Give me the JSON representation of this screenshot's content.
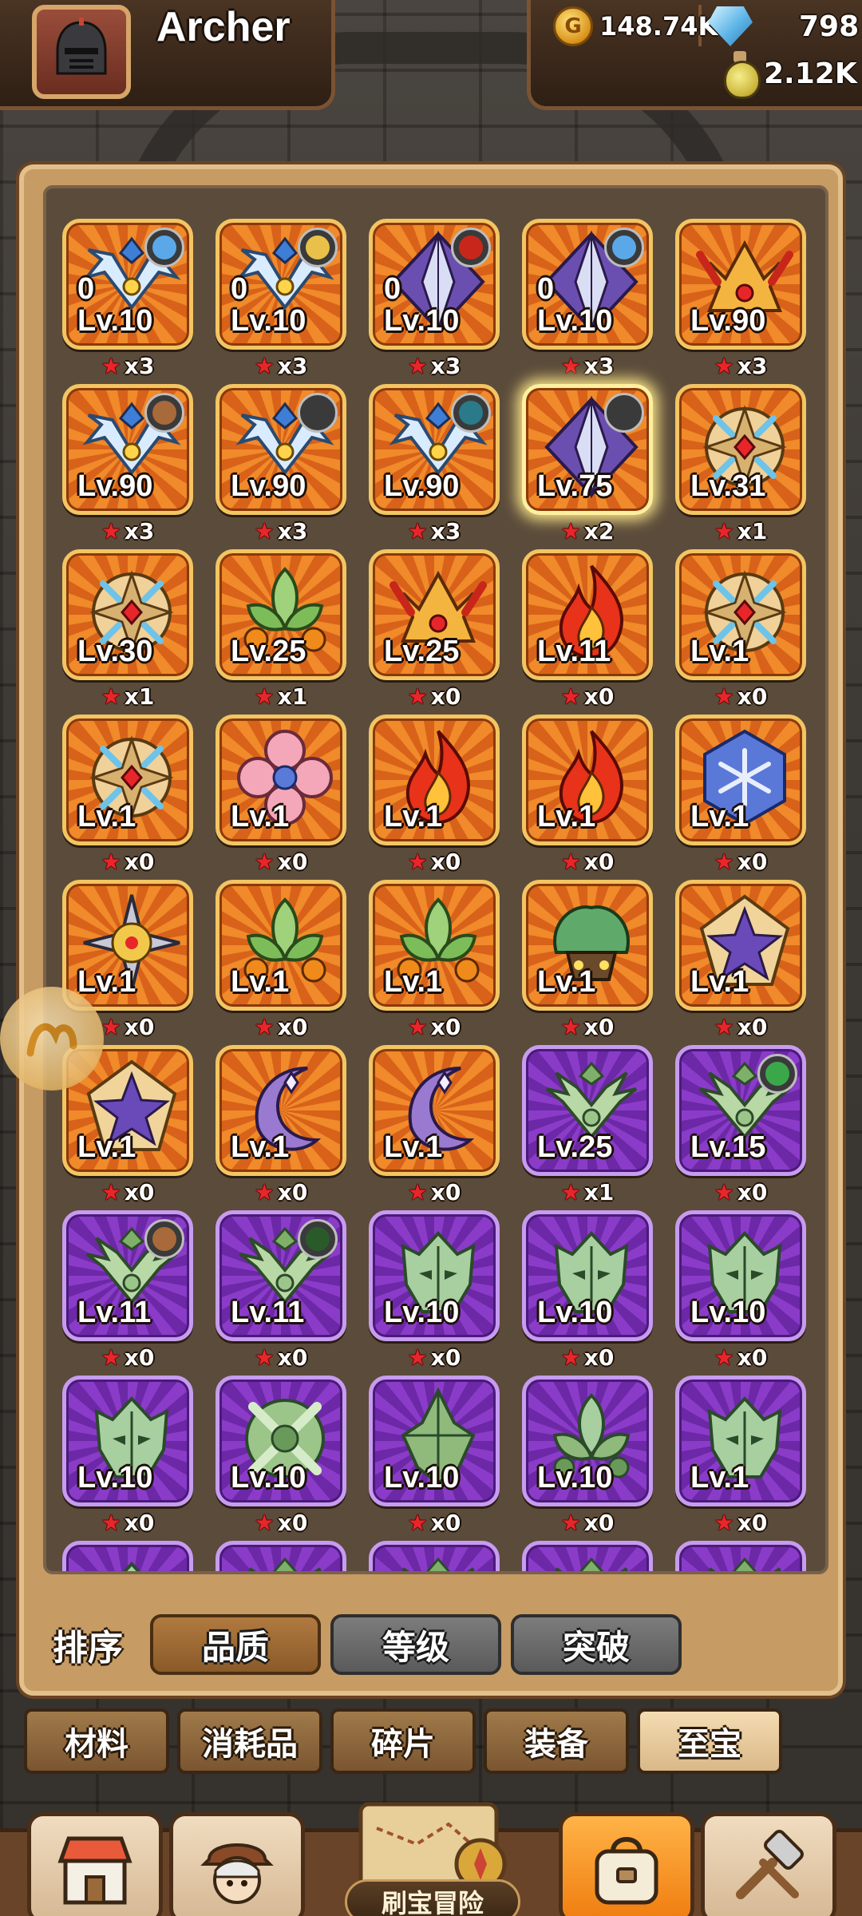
{
  "player": {
    "name": "Archer"
  },
  "resources": {
    "gold": "148.74K",
    "gems": "798",
    "potion": "2.12K"
  },
  "inventory": {
    "items": [
      {
        "rarity": "orange",
        "art": "wings-blue",
        "level": "Lv.10",
        "sub": "0",
        "count": "x3",
        "hero": "blue"
      },
      {
        "rarity": "orange",
        "art": "wings-blue",
        "level": "Lv.10",
        "sub": "0",
        "count": "x3",
        "hero": "gold"
      },
      {
        "rarity": "orange",
        "art": "diamond",
        "level": "Lv.10",
        "sub": "0",
        "count": "x3",
        "hero": "red"
      },
      {
        "rarity": "orange",
        "art": "diamond",
        "level": "Lv.10",
        "sub": "0",
        "count": "x3",
        "hero": "blue"
      },
      {
        "rarity": "orange",
        "art": "flame-crown",
        "level": "Lv.90",
        "sub": "",
        "count": "x3",
        "hero": ""
      },
      {
        "rarity": "orange",
        "art": "wings-blue",
        "level": "Lv.90",
        "sub": "",
        "count": "x3",
        "hero": "brown"
      },
      {
        "rarity": "orange",
        "art": "wings-blue",
        "level": "Lv.90",
        "sub": "",
        "count": "x3",
        "hero": "dark"
      },
      {
        "rarity": "orange",
        "art": "wings-blue",
        "level": "Lv.90",
        "sub": "",
        "count": "x3",
        "hero": "teal"
      },
      {
        "rarity": "orange",
        "art": "diamond",
        "level": "Lv.75",
        "sub": "",
        "count": "x2",
        "hero": "dark",
        "selected": true
      },
      {
        "rarity": "orange",
        "art": "shield",
        "level": "Lv.31",
        "sub": "",
        "count": "x1",
        "hero": ""
      },
      {
        "rarity": "orange",
        "art": "shield",
        "level": "Lv.30",
        "sub": "",
        "count": "x1",
        "hero": ""
      },
      {
        "rarity": "orange",
        "art": "leaf",
        "level": "Lv.25",
        "sub": "",
        "count": "x1",
        "hero": ""
      },
      {
        "rarity": "orange",
        "art": "flame-crown",
        "level": "Lv.25",
        "sub": "",
        "count": "x0",
        "hero": ""
      },
      {
        "rarity": "orange",
        "art": "fire",
        "level": "Lv.11",
        "sub": "",
        "count": "x0",
        "hero": ""
      },
      {
        "rarity": "orange",
        "art": "shield",
        "level": "Lv.1",
        "sub": "",
        "count": "x0",
        "hero": ""
      },
      {
        "rarity": "orange",
        "art": "shield",
        "level": "Lv.1",
        "sub": "",
        "count": "x0",
        "hero": ""
      },
      {
        "rarity": "orange",
        "art": "flower",
        "level": "Lv.1",
        "sub": "",
        "count": "x0",
        "hero": ""
      },
      {
        "rarity": "orange",
        "art": "fire",
        "level": "Lv.1",
        "sub": "",
        "count": "x0",
        "hero": ""
      },
      {
        "rarity": "orange",
        "art": "fire",
        "level": "Lv.1",
        "sub": "",
        "count": "x0",
        "hero": ""
      },
      {
        "rarity": "orange",
        "art": "hex-snow",
        "level": "Lv.1",
        "sub": "",
        "count": "x0",
        "hero": ""
      },
      {
        "rarity": "orange",
        "art": "shuriken",
        "level": "Lv.1",
        "sub": "",
        "count": "x0",
        "hero": ""
      },
      {
        "rarity": "orange",
        "art": "leaf",
        "level": "Lv.1",
        "sub": "",
        "count": "x0",
        "hero": ""
      },
      {
        "rarity": "orange",
        "art": "leaf",
        "level": "Lv.1",
        "sub": "",
        "count": "x0",
        "hero": ""
      },
      {
        "rarity": "orange",
        "art": "tree",
        "level": "Lv.1",
        "sub": "",
        "count": "x0",
        "hero": ""
      },
      {
        "rarity": "orange",
        "art": "star-pentagon",
        "level": "Lv.1",
        "sub": "",
        "count": "x0",
        "hero": ""
      },
      {
        "rarity": "orange",
        "art": "star-pentagon",
        "level": "Lv.1",
        "sub": "",
        "count": "x0",
        "hero": ""
      },
      {
        "rarity": "orange",
        "art": "moon",
        "level": "Lv.1",
        "sub": "",
        "count": "x0",
        "hero": ""
      },
      {
        "rarity": "orange",
        "art": "moon",
        "level": "Lv.1",
        "sub": "",
        "count": "x0",
        "hero": ""
      },
      {
        "rarity": "purple",
        "art": "wings-green",
        "level": "Lv.25",
        "sub": "",
        "count": "x1",
        "hero": ""
      },
      {
        "rarity": "purple",
        "art": "wings-green",
        "level": "Lv.15",
        "sub": "",
        "count": "x0",
        "hero": "green"
      },
      {
        "rarity": "purple",
        "art": "wings-green",
        "level": "Lv.11",
        "sub": "",
        "count": "x0",
        "hero": "brown"
      },
      {
        "rarity": "purple",
        "art": "wings-green",
        "level": "Lv.11",
        "sub": "",
        "count": "x0",
        "hero": "hood"
      },
      {
        "rarity": "purple",
        "art": "mask-green",
        "level": "Lv.10",
        "sub": "",
        "count": "x0",
        "hero": ""
      },
      {
        "rarity": "purple",
        "art": "mask-green",
        "level": "Lv.10",
        "sub": "",
        "count": "x0",
        "hero": ""
      },
      {
        "rarity": "purple",
        "art": "mask-green",
        "level": "Lv.10",
        "sub": "",
        "count": "x0",
        "hero": ""
      },
      {
        "rarity": "purple",
        "art": "mask-green",
        "level": "Lv.10",
        "sub": "",
        "count": "x0",
        "hero": ""
      },
      {
        "rarity": "purple",
        "art": "cross-green",
        "level": "Lv.10",
        "sub": "",
        "count": "x0",
        "hero": ""
      },
      {
        "rarity": "purple",
        "art": "spike-green",
        "level": "Lv.10",
        "sub": "",
        "count": "x0",
        "hero": ""
      },
      {
        "rarity": "purple",
        "art": "leaf-green",
        "level": "Lv.10",
        "sub": "",
        "count": "x0",
        "hero": ""
      },
      {
        "rarity": "purple",
        "art": "mask-green",
        "level": "Lv.1",
        "sub": "",
        "count": "x0",
        "hero": ""
      },
      {
        "rarity": "purple",
        "art": "mask-green",
        "level": "",
        "sub": "",
        "count": "",
        "hero": ""
      },
      {
        "rarity": "purple",
        "art": "wings-green",
        "level": "",
        "sub": "",
        "count": "",
        "hero": ""
      },
      {
        "rarity": "purple",
        "art": "wings-green",
        "level": "",
        "sub": "",
        "count": "",
        "hero": ""
      },
      {
        "rarity": "purple",
        "art": "wings-green",
        "level": "",
        "sub": "",
        "count": "",
        "hero": ""
      },
      {
        "rarity": "purple",
        "art": "wings-green",
        "level": "",
        "sub": "",
        "count": "",
        "hero": ""
      }
    ]
  },
  "sort": {
    "label": "排序",
    "options": [
      "品质",
      "等级",
      "突破"
    ],
    "active": 0
  },
  "categories": {
    "tabs": [
      "材料",
      "消耗品",
      "碎片",
      "装备",
      "至宝"
    ],
    "active": 4
  },
  "bottom_nav": {
    "adventure_label": "刷宝冒险",
    "items": [
      "shop-icon",
      "hero-icon",
      "adventure-map-icon",
      "bag-icon",
      "forge-icon"
    ],
    "active": "bag-icon"
  },
  "colors": {
    "orange_rarity": "#f08a2a",
    "purple_rarity": "#8a3cc8",
    "star": "#e8262a",
    "panel": "#c69b64"
  }
}
